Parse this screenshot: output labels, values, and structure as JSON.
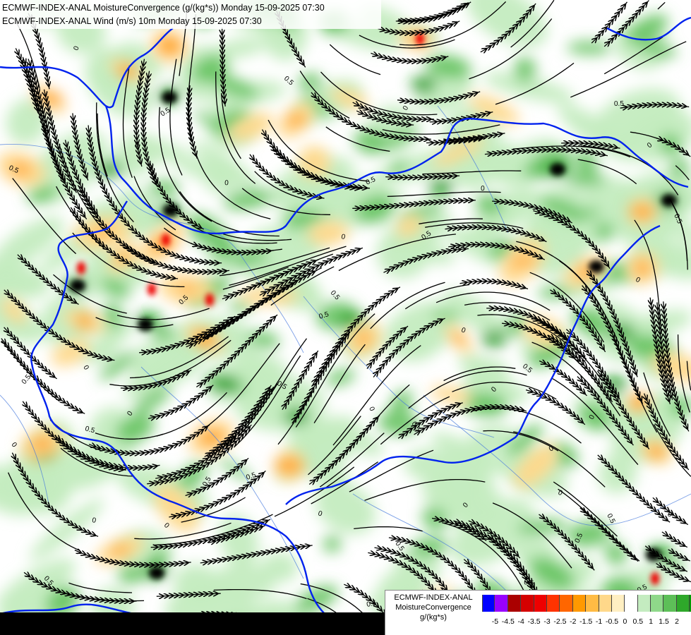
{
  "header": {
    "line1": "ECMWF-INDEX-ANAL MoistureConvergence (g/(kg*s)) Monday 15-09-2025 07:30",
    "line2": "ECMWF-INDEX-ANAL Wind (m/s) 10m Monday 15-09-2025 07:30"
  },
  "legend": {
    "title_line1": "ECMWF-INDEX-ANAL",
    "title_line2": "MoistureConvergence",
    "units": "g/(kg*s)",
    "levels": [
      "-5",
      "-4.5",
      "-4",
      "-3.5",
      "-3",
      "-2.5",
      "-2",
      "-1.5",
      "-1",
      "-0.5",
      "0",
      "0.5",
      "1",
      "1.5",
      "2"
    ],
    "colors": [
      "#0000ff",
      "#9900ff",
      "#aa0000",
      "#d40000",
      "#ee0000",
      "#ff3300",
      "#ff6600",
      "#ff9900",
      "#ffbb44",
      "#ffd88a",
      "#ffefc2",
      "#ffffff",
      "#c4ecc0",
      "#8fd88a",
      "#5dbf58",
      "#2ea82a",
      "#009900"
    ]
  },
  "map": {
    "contour_labels": [
      "0",
      "0.5",
      "-0.5"
    ],
    "colors": {
      "border": "#0022ee",
      "river": "#4477dd",
      "streamline": "#000000",
      "convergence_strong": "#009900",
      "convergence_moderate": "#5dbf58",
      "convergence_weak": "#c4ecc0",
      "divergence_weak": "#ffd88a",
      "divergence_moderate": "#ff9900",
      "divergence_strong": "#ee0000",
      "extreme": "#000000"
    }
  }
}
